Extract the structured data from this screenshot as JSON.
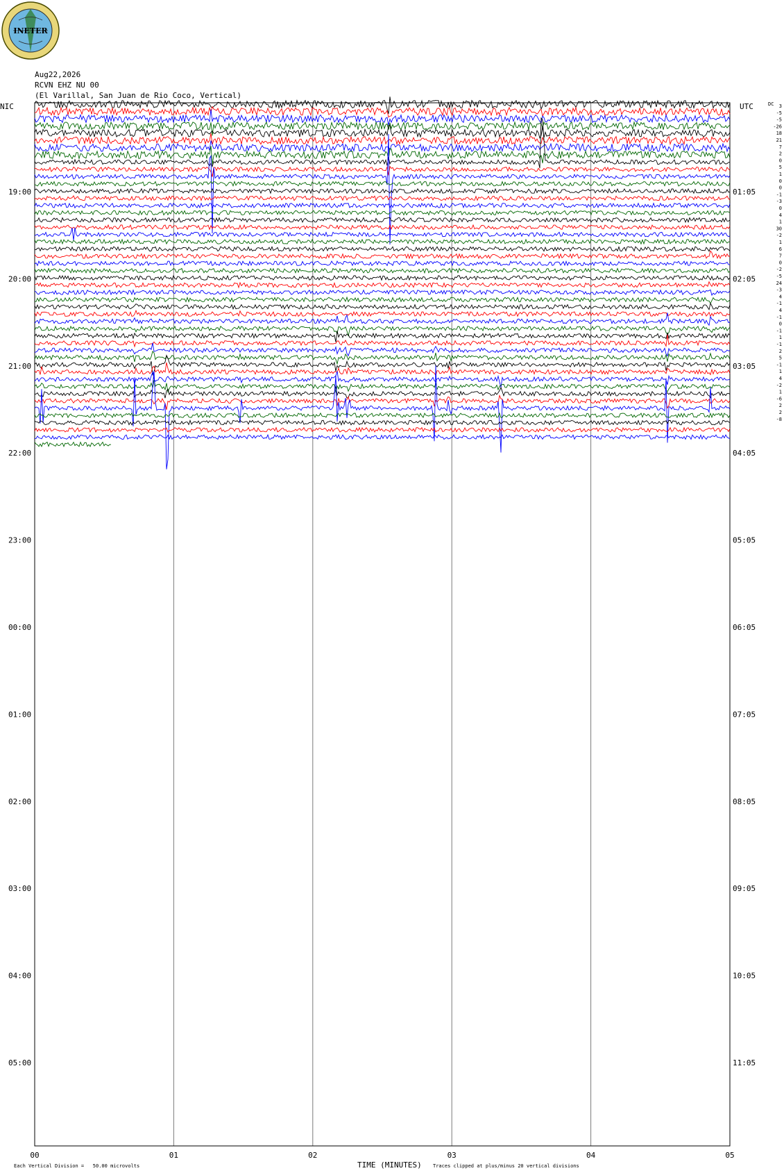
{
  "header": {
    "logo_text": "INETER",
    "date": "Aug22,2026",
    "station": "RCVN EHZ NU 00",
    "location": "(El Varillal, San Juan de Rio Coco, Vertical)"
  },
  "axes": {
    "left_tz": "NIC",
    "right_tz": "UTC",
    "dc_label": "DC",
    "left_hours": [
      "19:00",
      "20:00",
      "21:00",
      "22:00",
      "23:00",
      "00:00",
      "01:00",
      "02:00",
      "03:00",
      "04:00",
      "05:00"
    ],
    "right_hours": [
      "01:05",
      "02:05",
      "03:05",
      "04:05",
      "05:05",
      "06:05",
      "07:05",
      "08:05",
      "09:05",
      "10:05",
      "11:05"
    ],
    "x_ticks": [
      "00",
      "01",
      "02",
      "03",
      "04",
      "05"
    ],
    "x_title": "TIME (MINUTES)"
  },
  "footer": {
    "scale_note": "Each Vertical Division =   50.00 microvolts",
    "clip_note": "Traces clipped at plus/minus 20 vertical divisions"
  },
  "chart_data": {
    "type": "line",
    "title": "RCVN EHZ NU 00 (El Varillal, San Juan de Rio Coco, Vertical)",
    "xlabel": "TIME (MINUTES)",
    "xlim": [
      0,
      5
    ],
    "minutes_per_row": 5,
    "trace_colors": [
      "#000000",
      "#ff0000",
      "#0000ff",
      "#006600"
    ],
    "row_start_time_nic": "18:00",
    "row_count": 48,
    "dc_offsets": [
      3,
      -5,
      -5,
      -26,
      18,
      21,
      7,
      2,
      0,
      5,
      1,
      0,
      0,
      -1,
      -3,
      0,
      4,
      1,
      30,
      -2,
      1,
      6,
      7,
      0,
      -2,
      -5,
      24,
      -3,
      4,
      -1,
      4,
      -1,
      0,
      -1,
      1,
      -1,
      2,
      5,
      -1,
      1,
      4,
      -2,
      1,
      -6,
      2,
      2,
      -8
    ],
    "events": [
      {
        "minute": 0.05,
        "rows": [
          33,
          42
        ],
        "amp": 55,
        "color_index": 1
      },
      {
        "minute": 0.28,
        "rows": [
          4,
          18
        ],
        "amp": 30,
        "color_index": 2
      },
      {
        "minute": 0.72,
        "rows": [
          28,
          42
        ],
        "amp": 60,
        "color_index": 3
      },
      {
        "minute": 0.85,
        "rows": [
          34,
          42
        ],
        "amp": 120,
        "color_index": 2
      },
      {
        "minute": 0.95,
        "rows": [
          36,
          42
        ],
        "amp": 140,
        "color_index": 2
      },
      {
        "minute": 1.27,
        "rows": [
          0,
          10
        ],
        "amp": 140,
        "color_index": 2
      },
      {
        "minute": 1.48,
        "rows": [
          25,
          42
        ],
        "amp": 25,
        "color_index": 1
      },
      {
        "minute": 2.17,
        "rows": [
          30,
          42
        ],
        "amp": 110,
        "color_index": 0
      },
      {
        "minute": 2.25,
        "rows": [
          30,
          42
        ],
        "amp": 90,
        "color_index": 3
      },
      {
        "minute": 2.55,
        "rows": [
          0,
          10
        ],
        "amp": 140,
        "color_index": 2
      },
      {
        "minute": 2.88,
        "rows": [
          34,
          42
        ],
        "amp": 80,
        "color_index": 3
      },
      {
        "minute": 2.98,
        "rows": [
          34,
          42
        ],
        "amp": 70,
        "color_index": 3
      },
      {
        "minute": 3.35,
        "rows": [
          38,
          42
        ],
        "amp": 140,
        "color_index": 0
      },
      {
        "minute": 3.65,
        "rows": [
          0,
          8
        ],
        "amp": 110,
        "color_index": 3
      },
      {
        "minute": 4.55,
        "rows": [
          30,
          42
        ],
        "amp": 110,
        "color_index": 3
      },
      {
        "minute": 4.86,
        "rows": [
          20,
          42
        ],
        "amp": 50,
        "color_index": 0
      }
    ]
  }
}
